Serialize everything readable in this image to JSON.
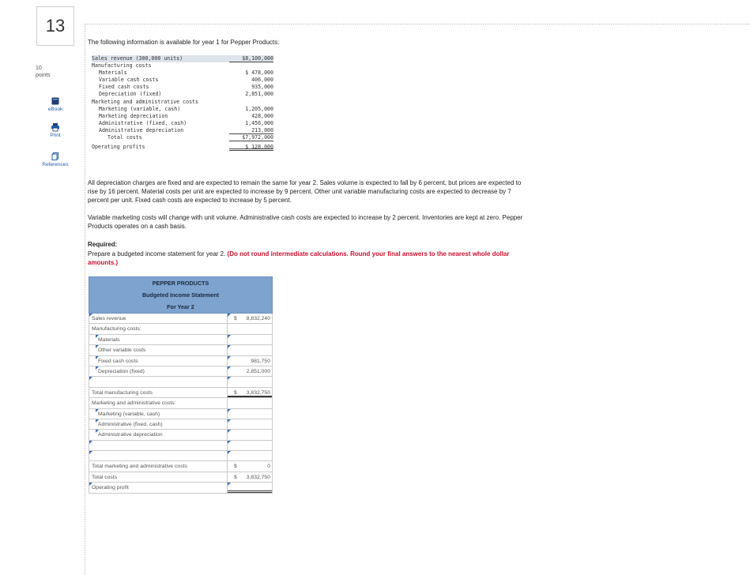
{
  "question": {
    "number": "13",
    "points_value": "10",
    "points_label": "points"
  },
  "tools": [
    {
      "label": "eBook",
      "icon": "book-icon"
    },
    {
      "label": "Print",
      "icon": "printer-icon"
    },
    {
      "label": "References",
      "icon": "document-icon"
    }
  ],
  "intro": "The following information is available for year 1 for Pepper Products:",
  "year1": {
    "rows": [
      {
        "label": "Sales revenue (300,000 units)",
        "value": "$8,100,000",
        "indent": 0
      },
      {
        "label": "Manufacturing costs",
        "value": "",
        "indent": 0
      },
      {
        "label": "Materials",
        "value": "$  478,000",
        "indent": 1
      },
      {
        "label": "Variable cash costs",
        "value": "406,000",
        "indent": 1
      },
      {
        "label": "Fixed cash costs",
        "value": "935,000",
        "indent": 1
      },
      {
        "label": "Depreciation (fixed)",
        "value": "2,851,000",
        "indent": 1
      },
      {
        "label": "Marketing and administrative costs",
        "value": "",
        "indent": 0
      },
      {
        "label": "Marketing (variable, cash)",
        "value": "1,205,000",
        "indent": 1
      },
      {
        "label": "Marketing depreciation",
        "value": "428,000",
        "indent": 1
      },
      {
        "label": "Administrative (fixed, cash)",
        "value": "1,456,000",
        "indent": 1
      },
      {
        "label": "Administrative depreciation",
        "value": "213,000",
        "indent": 1
      },
      {
        "label": "Total costs",
        "value": "$7,972,000",
        "indent": 2
      },
      {
        "label": "Operating profits",
        "value": "$  128,000",
        "indent": 0
      }
    ]
  },
  "paragraph1": "All depreciation charges are fixed and are expected to remain the same for year 2. Sales volume is expected to fall by 6 percent, but prices are expected to rise by 16 percent. Material costs per unit are expected to increase by 9 percent. Other unit variable manufacturing costs are expected to decrease by 7 percent per unit. Fixed cash costs are expected to increase by 5 percent.",
  "paragraph2": "Variable marketing costs will change with unit volume. Administrative cash costs are expected to increase by 2 percent. Inventories are kept at zero. Pepper Products operates on a cash basis.",
  "required": {
    "label": "Required:",
    "text": "Prepare a budgeted income statement for year 2. ",
    "emphasis": "(Do not round intermediate calculations. Round your final answers to the nearest whole dollar amounts.)"
  },
  "budget": {
    "company": "PEPPER PRODUCTS",
    "title": "Budgeted Income Statement",
    "period": "For Year 2",
    "rows": [
      {
        "label": "Sales revenue",
        "dollar": "$",
        "amount": "8,832,240"
      },
      {
        "label": "Manufacturing costs:",
        "dollar": "",
        "amount": ""
      },
      {
        "label": "Materials",
        "dollar": "",
        "amount": ""
      },
      {
        "label": "Other variable costs",
        "dollar": "",
        "amount": ""
      },
      {
        "label": "Fixed cash costs",
        "dollar": "",
        "amount": "981,750"
      },
      {
        "label": "Depreciation (fixed)",
        "dollar": "",
        "amount": "2,851,000"
      },
      {
        "label": "",
        "dollar": "",
        "amount": ""
      },
      {
        "label": "Total manufacturing costs",
        "dollar": "$",
        "amount": "3,832,750"
      },
      {
        "label": "Marketing and administrative costs:",
        "dollar": "",
        "amount": ""
      },
      {
        "label": "Marketing (variable, cash)",
        "dollar": "",
        "amount": ""
      },
      {
        "label": "Administrative (fixed, cash)",
        "dollar": "",
        "amount": ""
      },
      {
        "label": "Administrative depreciation",
        "dollar": "",
        "amount": ""
      },
      {
        "label": "",
        "dollar": "",
        "amount": ""
      },
      {
        "label": "",
        "dollar": "",
        "amount": ""
      },
      {
        "label": "Total marketing and administrative costs",
        "dollar": "$",
        "amount": "0"
      },
      {
        "label": "Total costs",
        "dollar": "$",
        "amount": "3,832,750"
      },
      {
        "label": "Operating profit",
        "dollar": "",
        "amount": ""
      }
    ]
  }
}
